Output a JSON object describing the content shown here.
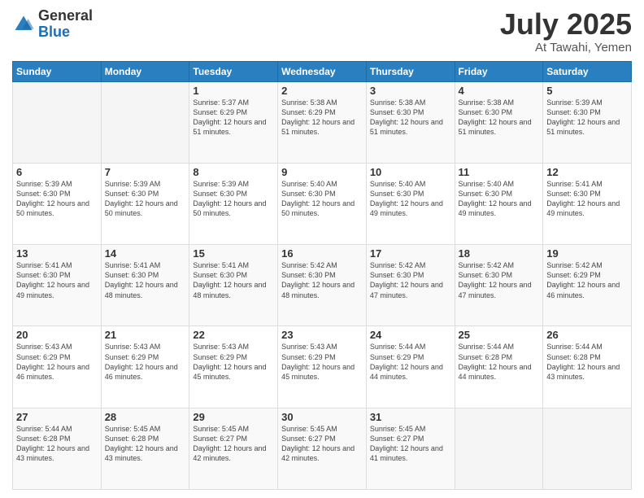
{
  "header": {
    "logo_general": "General",
    "logo_blue": "Blue",
    "title": "July 2025",
    "location": "At Tawahi, Yemen"
  },
  "days_of_week": [
    "Sunday",
    "Monday",
    "Tuesday",
    "Wednesday",
    "Thursday",
    "Friday",
    "Saturday"
  ],
  "weeks": [
    [
      {
        "day": "",
        "sunrise": "",
        "sunset": "",
        "daylight": ""
      },
      {
        "day": "",
        "sunrise": "",
        "sunset": "",
        "daylight": ""
      },
      {
        "day": "1",
        "sunrise": "Sunrise: 5:37 AM",
        "sunset": "Sunset: 6:29 PM",
        "daylight": "Daylight: 12 hours and 51 minutes."
      },
      {
        "day": "2",
        "sunrise": "Sunrise: 5:38 AM",
        "sunset": "Sunset: 6:29 PM",
        "daylight": "Daylight: 12 hours and 51 minutes."
      },
      {
        "day": "3",
        "sunrise": "Sunrise: 5:38 AM",
        "sunset": "Sunset: 6:30 PM",
        "daylight": "Daylight: 12 hours and 51 minutes."
      },
      {
        "day": "4",
        "sunrise": "Sunrise: 5:38 AM",
        "sunset": "Sunset: 6:30 PM",
        "daylight": "Daylight: 12 hours and 51 minutes."
      },
      {
        "day": "5",
        "sunrise": "Sunrise: 5:39 AM",
        "sunset": "Sunset: 6:30 PM",
        "daylight": "Daylight: 12 hours and 51 minutes."
      }
    ],
    [
      {
        "day": "6",
        "sunrise": "Sunrise: 5:39 AM",
        "sunset": "Sunset: 6:30 PM",
        "daylight": "Daylight: 12 hours and 50 minutes."
      },
      {
        "day": "7",
        "sunrise": "Sunrise: 5:39 AM",
        "sunset": "Sunset: 6:30 PM",
        "daylight": "Daylight: 12 hours and 50 minutes."
      },
      {
        "day": "8",
        "sunrise": "Sunrise: 5:39 AM",
        "sunset": "Sunset: 6:30 PM",
        "daylight": "Daylight: 12 hours and 50 minutes."
      },
      {
        "day": "9",
        "sunrise": "Sunrise: 5:40 AM",
        "sunset": "Sunset: 6:30 PM",
        "daylight": "Daylight: 12 hours and 50 minutes."
      },
      {
        "day": "10",
        "sunrise": "Sunrise: 5:40 AM",
        "sunset": "Sunset: 6:30 PM",
        "daylight": "Daylight: 12 hours and 49 minutes."
      },
      {
        "day": "11",
        "sunrise": "Sunrise: 5:40 AM",
        "sunset": "Sunset: 6:30 PM",
        "daylight": "Daylight: 12 hours and 49 minutes."
      },
      {
        "day": "12",
        "sunrise": "Sunrise: 5:41 AM",
        "sunset": "Sunset: 6:30 PM",
        "daylight": "Daylight: 12 hours and 49 minutes."
      }
    ],
    [
      {
        "day": "13",
        "sunrise": "Sunrise: 5:41 AM",
        "sunset": "Sunset: 6:30 PM",
        "daylight": "Daylight: 12 hours and 49 minutes."
      },
      {
        "day": "14",
        "sunrise": "Sunrise: 5:41 AM",
        "sunset": "Sunset: 6:30 PM",
        "daylight": "Daylight: 12 hours and 48 minutes."
      },
      {
        "day": "15",
        "sunrise": "Sunrise: 5:41 AM",
        "sunset": "Sunset: 6:30 PM",
        "daylight": "Daylight: 12 hours and 48 minutes."
      },
      {
        "day": "16",
        "sunrise": "Sunrise: 5:42 AM",
        "sunset": "Sunset: 6:30 PM",
        "daylight": "Daylight: 12 hours and 48 minutes."
      },
      {
        "day": "17",
        "sunrise": "Sunrise: 5:42 AM",
        "sunset": "Sunset: 6:30 PM",
        "daylight": "Daylight: 12 hours and 47 minutes."
      },
      {
        "day": "18",
        "sunrise": "Sunrise: 5:42 AM",
        "sunset": "Sunset: 6:30 PM",
        "daylight": "Daylight: 12 hours and 47 minutes."
      },
      {
        "day": "19",
        "sunrise": "Sunrise: 5:42 AM",
        "sunset": "Sunset: 6:29 PM",
        "daylight": "Daylight: 12 hours and 46 minutes."
      }
    ],
    [
      {
        "day": "20",
        "sunrise": "Sunrise: 5:43 AM",
        "sunset": "Sunset: 6:29 PM",
        "daylight": "Daylight: 12 hours and 46 minutes."
      },
      {
        "day": "21",
        "sunrise": "Sunrise: 5:43 AM",
        "sunset": "Sunset: 6:29 PM",
        "daylight": "Daylight: 12 hours and 46 minutes."
      },
      {
        "day": "22",
        "sunrise": "Sunrise: 5:43 AM",
        "sunset": "Sunset: 6:29 PM",
        "daylight": "Daylight: 12 hours and 45 minutes."
      },
      {
        "day": "23",
        "sunrise": "Sunrise: 5:43 AM",
        "sunset": "Sunset: 6:29 PM",
        "daylight": "Daylight: 12 hours and 45 minutes."
      },
      {
        "day": "24",
        "sunrise": "Sunrise: 5:44 AM",
        "sunset": "Sunset: 6:29 PM",
        "daylight": "Daylight: 12 hours and 44 minutes."
      },
      {
        "day": "25",
        "sunrise": "Sunrise: 5:44 AM",
        "sunset": "Sunset: 6:28 PM",
        "daylight": "Daylight: 12 hours and 44 minutes."
      },
      {
        "day": "26",
        "sunrise": "Sunrise: 5:44 AM",
        "sunset": "Sunset: 6:28 PM",
        "daylight": "Daylight: 12 hours and 43 minutes."
      }
    ],
    [
      {
        "day": "27",
        "sunrise": "Sunrise: 5:44 AM",
        "sunset": "Sunset: 6:28 PM",
        "daylight": "Daylight: 12 hours and 43 minutes."
      },
      {
        "day": "28",
        "sunrise": "Sunrise: 5:45 AM",
        "sunset": "Sunset: 6:28 PM",
        "daylight": "Daylight: 12 hours and 43 minutes."
      },
      {
        "day": "29",
        "sunrise": "Sunrise: 5:45 AM",
        "sunset": "Sunset: 6:27 PM",
        "daylight": "Daylight: 12 hours and 42 minutes."
      },
      {
        "day": "30",
        "sunrise": "Sunrise: 5:45 AM",
        "sunset": "Sunset: 6:27 PM",
        "daylight": "Daylight: 12 hours and 42 minutes."
      },
      {
        "day": "31",
        "sunrise": "Sunrise: 5:45 AM",
        "sunset": "Sunset: 6:27 PM",
        "daylight": "Daylight: 12 hours and 41 minutes."
      },
      {
        "day": "",
        "sunrise": "",
        "sunset": "",
        "daylight": ""
      },
      {
        "day": "",
        "sunrise": "",
        "sunset": "",
        "daylight": ""
      }
    ]
  ]
}
